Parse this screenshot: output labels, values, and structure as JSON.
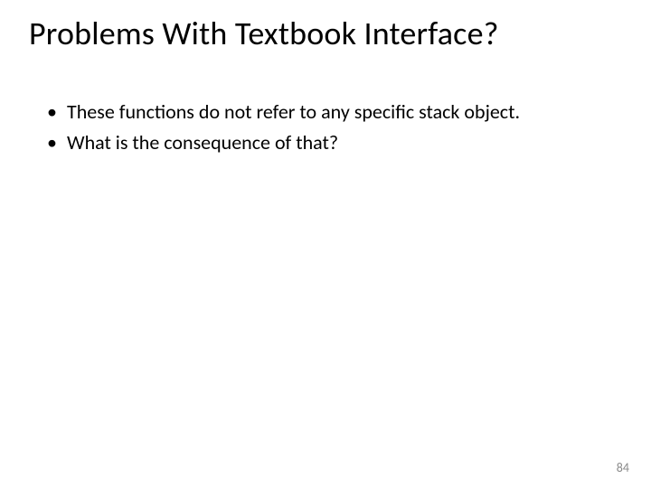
{
  "slide": {
    "title": "Problems With Textbook Interface?",
    "bullets": [
      "These functions do not refer to any specific stack object.",
      "What is the consequence of that?"
    ],
    "page_number": "84"
  }
}
